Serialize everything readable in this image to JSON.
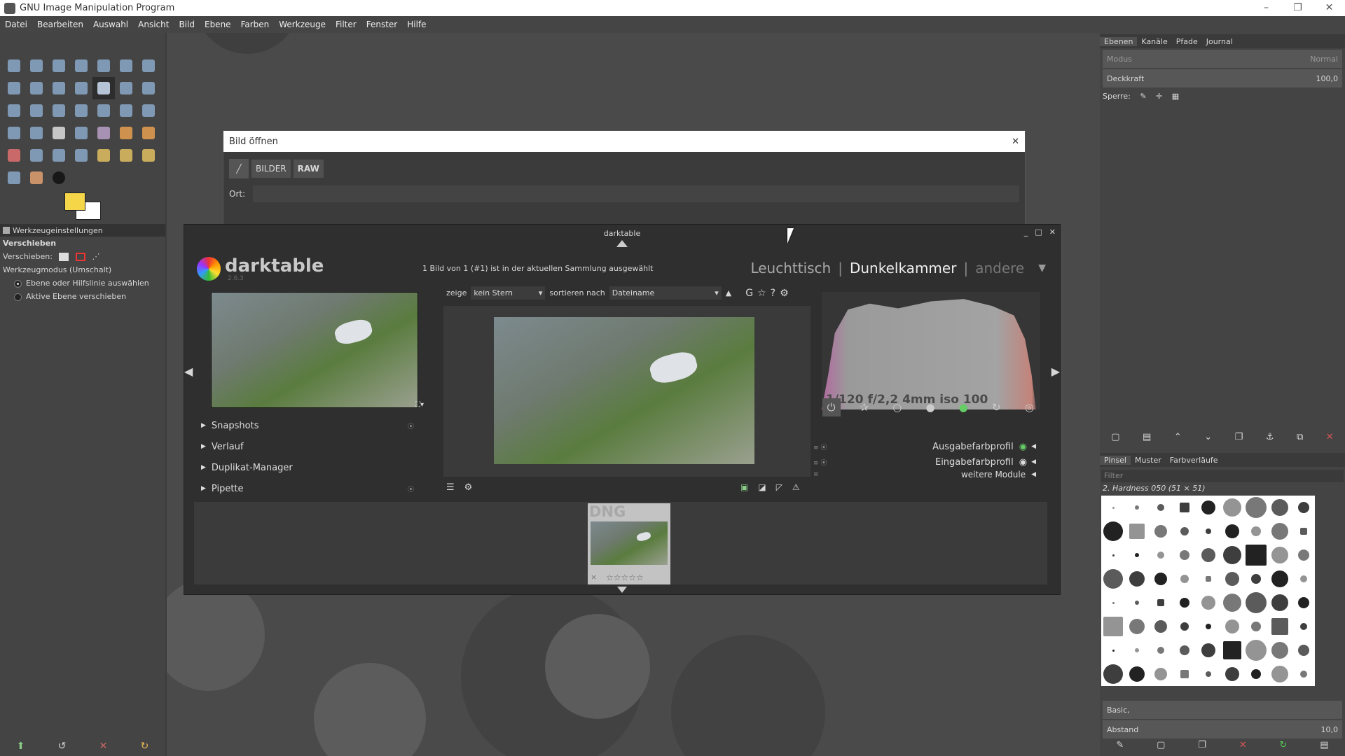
{
  "titlebar": {
    "title": "GNU Image Manipulation Program"
  },
  "window_controls": {
    "minimize": "–",
    "maximize": "❐",
    "close": "✕"
  },
  "menu": [
    "Datei",
    "Bearbeiten",
    "Auswahl",
    "Ansicht",
    "Bild",
    "Ebene",
    "Farben",
    "Werkzeuge",
    "Filter",
    "Fenster",
    "Hilfe"
  ],
  "tool_options": {
    "tab": "Werkzeugeinstellungen",
    "title": "Verschieben",
    "move_label": "Verschieben:",
    "mode_label": "Werkzeugmodus (Umschalt)",
    "opt1": "Ebene oder Hilfslinie auswählen",
    "opt2": "Aktive Ebene verschieben"
  },
  "layers": {
    "tabs": [
      "Ebenen",
      "Kanäle",
      "Pfade",
      "Journal"
    ],
    "mode_label": "Modus",
    "mode_value": "Normal",
    "opacity_label": "Deckkraft",
    "opacity_value": "100,0",
    "lock_label": "Sperre:"
  },
  "brushes": {
    "tabs": [
      "Pinsel",
      "Muster",
      "Farbverläufe"
    ],
    "filter_placeholder": "Filter",
    "selected": "2. Hardness 050 (51 × 51)",
    "preset": "Basic,",
    "spacing_label": "Abstand",
    "spacing_value": "10,0"
  },
  "open_dialog": {
    "title": "Bild öffnen",
    "path": [
      "BILDER",
      "RAW"
    ],
    "location_label": "Ort:",
    "close": "✕"
  },
  "darktable": {
    "window_title": "darktable",
    "logo": "darktable",
    "version": "2.6.3",
    "status": "1 Bild von 1 (#1) ist in der aktuellen Sammlung ausgewählt",
    "views": [
      "Leuchttisch",
      "Dunkelkammer",
      "andere"
    ],
    "sep": "|",
    "show_label": "zeige",
    "show_value": "kein Stern",
    "sort_label": "sortieren nach",
    "sort_value": "Dateiname",
    "left_modules": [
      "Snapshots",
      "Verlauf",
      "Duplikat-Manager",
      "Pipette"
    ],
    "exif": "1/120 f/2,2 4mm iso 100",
    "right_modules": [
      "Ausgabefarbprofil",
      "Eingabefarbprofil"
    ],
    "more_modules": "weitere Module",
    "film_format": "DNG",
    "film_close": "×",
    "stars": "☆☆☆☆☆"
  }
}
